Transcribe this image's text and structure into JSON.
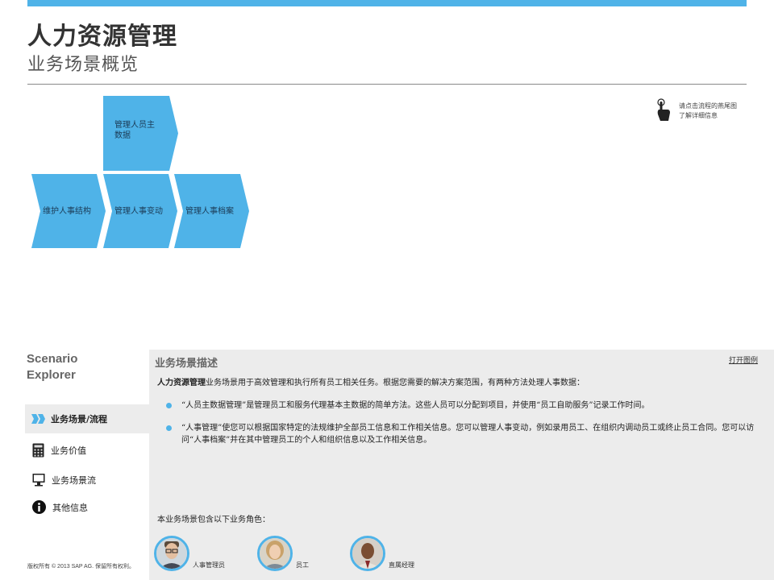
{
  "header": {
    "title": "人力资源管理",
    "subtitle": "业务场景概览"
  },
  "colors": {
    "accent": "#4fb3e8",
    "chevron_text": "#1b3a55",
    "panel_bg": "#ececec"
  },
  "flow": {
    "steps": [
      {
        "label_line1": "管理人员主",
        "label_line2": "数据"
      },
      {
        "label_line1": "维护人事结构"
      },
      {
        "label_line1": "管理人事变动"
      },
      {
        "label_line1": "管理人事档案"
      }
    ]
  },
  "hint": {
    "icon": "pointing-hand-icon",
    "line1": "请点击流程的燕尾图",
    "line2": "了解详细信息"
  },
  "sidebar": {
    "title_line1": "Scenario",
    "title_line2": "Explorer",
    "items": [
      {
        "label": "业务场景/流程",
        "icon": "double-chevron-icon",
        "active": true
      },
      {
        "label": "业务价值",
        "icon": "calculator-icon"
      },
      {
        "label": "业务场景流",
        "icon": "monitor-icon"
      },
      {
        "label": "其他信息",
        "icon": "info-icon"
      }
    ]
  },
  "description": {
    "title": "业务场景描述",
    "legend_link": "打开图例",
    "intro_bold": "人力资源管理",
    "intro_rest": "业务场景用于高效管理和执行所有员工相关任务。根据您需要的解决方案范围，有两种方法处理人事数据：",
    "bullets": [
      "“人员主数据管理”是管理员工和服务代理基本主数据的简单方法。这些人员可以分配到项目，并使用“员工自助服务”记录工作时间。",
      "“人事管理”使您可以根据国家特定的法规维护全部员工信息和工作相关信息。您可以管理人事变动，例如录用员工、在组织内调动员工或终止员工合同。您可以访问“人事档案”并在其中管理员工的个人和组织信息以及工作相关信息。"
    ],
    "roles_intro": "本业务场景包含以下业务角色：",
    "roles": [
      {
        "label": "人事管理员"
      },
      {
        "label": "员工"
      },
      {
        "label": "直属经理"
      }
    ]
  },
  "footer": {
    "copyright": "版权所有 © 2013 SAP AG. 保留所有权利。"
  }
}
